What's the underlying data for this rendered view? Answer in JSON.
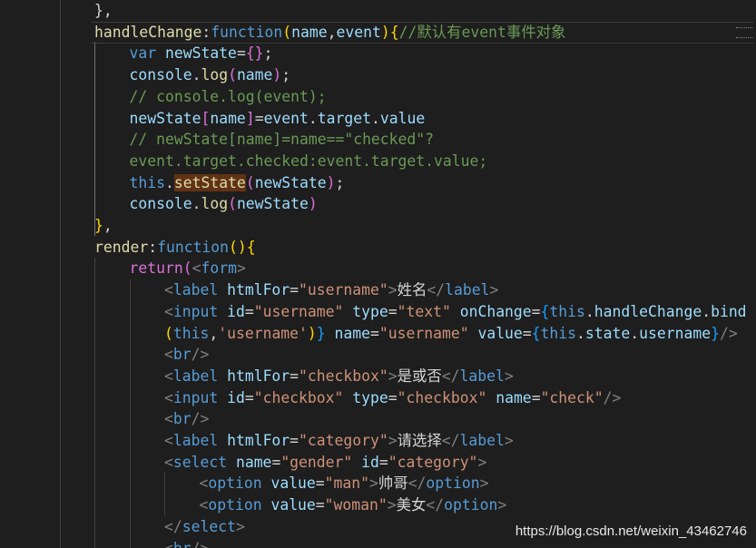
{
  "editor": {
    "lines": [
      {
        "indent": 2,
        "tokens": [
          {
            "t": "},",
            "c": "t-punc"
          }
        ]
      },
      {
        "indent": 2,
        "current": true,
        "tokens": [
          {
            "t": "handleChange",
            "c": "t-fn"
          },
          {
            "t": ":",
            "c": "t-punc"
          },
          {
            "t": "function",
            "c": "t-kw"
          },
          {
            "t": "(",
            "c": "t-brace1"
          },
          {
            "t": "name",
            "c": "t-var"
          },
          {
            "t": ",",
            "c": "t-punc"
          },
          {
            "t": "event",
            "c": "t-var"
          },
          {
            "t": ")",
            "c": "t-brace1"
          },
          {
            "t": "{",
            "c": "t-brace1"
          },
          {
            "t": "//默认有event事件对象",
            "c": "t-cmt"
          }
        ]
      },
      {
        "indent": 3,
        "tokens": [
          {
            "t": "var ",
            "c": "t-kw"
          },
          {
            "t": "newState",
            "c": "t-var"
          },
          {
            "t": "=",
            "c": "t-punc"
          },
          {
            "t": "{}",
            "c": "t-brace2"
          },
          {
            "t": ";",
            "c": "t-punc"
          }
        ]
      },
      {
        "indent": 3,
        "tokens": [
          {
            "t": "console",
            "c": "t-var"
          },
          {
            "t": ".",
            "c": "t-punc"
          },
          {
            "t": "log",
            "c": "t-fn"
          },
          {
            "t": "(",
            "c": "t-brace2"
          },
          {
            "t": "name",
            "c": "t-var"
          },
          {
            "t": ")",
            "c": "t-brace2"
          },
          {
            "t": ";",
            "c": "t-punc"
          }
        ]
      },
      {
        "indent": 3,
        "tokens": [
          {
            "t": "// console.log(event);",
            "c": "t-cmt"
          }
        ]
      },
      {
        "indent": 3,
        "tokens": [
          {
            "t": "newState",
            "c": "t-var"
          },
          {
            "t": "[",
            "c": "t-brace2"
          },
          {
            "t": "name",
            "c": "t-var"
          },
          {
            "t": "]",
            "c": "t-brace2"
          },
          {
            "t": "=",
            "c": "t-punc"
          },
          {
            "t": "event",
            "c": "t-var"
          },
          {
            "t": ".",
            "c": "t-punc"
          },
          {
            "t": "target",
            "c": "t-var"
          },
          {
            "t": ".",
            "c": "t-punc"
          },
          {
            "t": "value",
            "c": "t-var"
          }
        ]
      },
      {
        "indent": 3,
        "tokens": [
          {
            "t": "// newState[name]=name==\"checked\"?",
            "c": "t-cmt"
          }
        ]
      },
      {
        "indent": 3,
        "tokens": [
          {
            "t": "event.target.checked:event.target.value;",
            "c": "t-cmt"
          }
        ]
      },
      {
        "indent": 3,
        "tokens": [
          {
            "t": "this",
            "c": "t-this"
          },
          {
            "t": ".",
            "c": "t-punc"
          },
          {
            "t": "setState",
            "c": "t-fn t-sel"
          },
          {
            "t": "(",
            "c": "t-brace2"
          },
          {
            "t": "newState",
            "c": "t-var"
          },
          {
            "t": ")",
            "c": "t-brace2"
          },
          {
            "t": ";",
            "c": "t-punc"
          }
        ]
      },
      {
        "indent": 3,
        "tokens": [
          {
            "t": "console",
            "c": "t-var"
          },
          {
            "t": ".",
            "c": "t-punc"
          },
          {
            "t": "log",
            "c": "t-fn"
          },
          {
            "t": "(",
            "c": "t-brace2"
          },
          {
            "t": "newState",
            "c": "t-var"
          },
          {
            "t": ")",
            "c": "t-brace2"
          }
        ]
      },
      {
        "indent": 2,
        "tokens": [
          {
            "t": "}",
            "c": "t-brace1"
          },
          {
            "t": ",",
            "c": "t-punc"
          }
        ]
      },
      {
        "indent": 2,
        "tokens": [
          {
            "t": "render",
            "c": "t-fn"
          },
          {
            "t": ":",
            "c": "t-punc"
          },
          {
            "t": "function",
            "c": "t-kw"
          },
          {
            "t": "()",
            "c": "t-brace1"
          },
          {
            "t": "{",
            "c": "t-brace1"
          }
        ]
      },
      {
        "indent": 3,
        "tokens": [
          {
            "t": "return",
            "c": "t-brace2"
          },
          {
            "t": "(",
            "c": "t-brace2"
          },
          {
            "t": "<",
            "c": "t-ang"
          },
          {
            "t": "form",
            "c": "t-tag"
          },
          {
            "t": ">",
            "c": "t-ang"
          }
        ]
      },
      {
        "indent": 4,
        "tokens": [
          {
            "t": "<",
            "c": "t-ang"
          },
          {
            "t": "label ",
            "c": "t-tag"
          },
          {
            "t": "htmlFor",
            "c": "t-attr"
          },
          {
            "t": "=",
            "c": "t-punc"
          },
          {
            "t": "\"username\"",
            "c": "t-str"
          },
          {
            "t": ">",
            "c": "t-ang"
          },
          {
            "t": "姓名",
            "c": "t-text"
          },
          {
            "t": "</",
            "c": "t-ang"
          },
          {
            "t": "label",
            "c": "t-tag"
          },
          {
            "t": ">",
            "c": "t-ang"
          }
        ]
      },
      {
        "indent": 4,
        "tokens": [
          {
            "t": "<",
            "c": "t-ang"
          },
          {
            "t": "input ",
            "c": "t-tag"
          },
          {
            "t": "id",
            "c": "t-attr"
          },
          {
            "t": "=",
            "c": "t-punc"
          },
          {
            "t": "\"username\" ",
            "c": "t-str"
          },
          {
            "t": "type",
            "c": "t-attr"
          },
          {
            "t": "=",
            "c": "t-punc"
          },
          {
            "t": "\"text\" ",
            "c": "t-str"
          },
          {
            "t": "onChange",
            "c": "t-attr"
          },
          {
            "t": "=",
            "c": "t-punc"
          },
          {
            "t": "{",
            "c": "t-brace3"
          },
          {
            "t": "this",
            "c": "t-this"
          },
          {
            "t": ".",
            "c": "t-punc"
          },
          {
            "t": "handleChange",
            "c": "t-var"
          },
          {
            "t": ".",
            "c": "t-punc"
          },
          {
            "t": "bind",
            "c": "t-var"
          }
        ]
      },
      {
        "indent": 4,
        "tokens": [
          {
            "t": "(",
            "c": "t-brace1"
          },
          {
            "t": "this",
            "c": "t-this"
          },
          {
            "t": ",",
            "c": "t-punc"
          },
          {
            "t": "'username'",
            "c": "t-str"
          },
          {
            "t": ")",
            "c": "t-brace1"
          },
          {
            "t": "}",
            "c": "t-brace3"
          },
          {
            "t": " name",
            "c": "t-attr"
          },
          {
            "t": "=",
            "c": "t-punc"
          },
          {
            "t": "\"username\" ",
            "c": "t-str"
          },
          {
            "t": "value",
            "c": "t-attr"
          },
          {
            "t": "=",
            "c": "t-punc"
          },
          {
            "t": "{",
            "c": "t-brace3"
          },
          {
            "t": "this",
            "c": "t-this"
          },
          {
            "t": ".",
            "c": "t-punc"
          },
          {
            "t": "state",
            "c": "t-var"
          },
          {
            "t": ".",
            "c": "t-punc"
          },
          {
            "t": "username",
            "c": "t-var"
          },
          {
            "t": "}",
            "c": "t-brace3"
          },
          {
            "t": "/>",
            "c": "t-ang"
          }
        ]
      },
      {
        "indent": 4,
        "tokens": [
          {
            "t": "<",
            "c": "t-ang"
          },
          {
            "t": "br",
            "c": "t-tag"
          },
          {
            "t": "/>",
            "c": "t-ang"
          }
        ]
      },
      {
        "indent": 4,
        "tokens": [
          {
            "t": "<",
            "c": "t-ang"
          },
          {
            "t": "label ",
            "c": "t-tag"
          },
          {
            "t": "htmlFor",
            "c": "t-attr"
          },
          {
            "t": "=",
            "c": "t-punc"
          },
          {
            "t": "\"checkbox\"",
            "c": "t-str"
          },
          {
            "t": ">",
            "c": "t-ang"
          },
          {
            "t": "是或否",
            "c": "t-text"
          },
          {
            "t": "</",
            "c": "t-ang"
          },
          {
            "t": "label",
            "c": "t-tag"
          },
          {
            "t": ">",
            "c": "t-ang"
          }
        ]
      },
      {
        "indent": 4,
        "tokens": [
          {
            "t": "<",
            "c": "t-ang"
          },
          {
            "t": "input ",
            "c": "t-tag"
          },
          {
            "t": "id",
            "c": "t-attr"
          },
          {
            "t": "=",
            "c": "t-punc"
          },
          {
            "t": "\"checkbox\" ",
            "c": "t-str"
          },
          {
            "t": "type",
            "c": "t-attr"
          },
          {
            "t": "=",
            "c": "t-punc"
          },
          {
            "t": "\"checkbox\" ",
            "c": "t-str"
          },
          {
            "t": "name",
            "c": "t-attr"
          },
          {
            "t": "=",
            "c": "t-punc"
          },
          {
            "t": "\"check\"",
            "c": "t-str"
          },
          {
            "t": "/>",
            "c": "t-ang"
          }
        ]
      },
      {
        "indent": 4,
        "tokens": [
          {
            "t": "<",
            "c": "t-ang"
          },
          {
            "t": "br",
            "c": "t-tag"
          },
          {
            "t": "/>",
            "c": "t-ang"
          }
        ]
      },
      {
        "indent": 4,
        "tokens": [
          {
            "t": "<",
            "c": "t-ang"
          },
          {
            "t": "label ",
            "c": "t-tag"
          },
          {
            "t": "htmlFor",
            "c": "t-attr"
          },
          {
            "t": "=",
            "c": "t-punc"
          },
          {
            "t": "\"category\"",
            "c": "t-str"
          },
          {
            "t": ">",
            "c": "t-ang"
          },
          {
            "t": "请选择",
            "c": "t-text"
          },
          {
            "t": "</",
            "c": "t-ang"
          },
          {
            "t": "label",
            "c": "t-tag"
          },
          {
            "t": ">",
            "c": "t-ang"
          }
        ]
      },
      {
        "indent": 4,
        "tokens": [
          {
            "t": "<",
            "c": "t-ang"
          },
          {
            "t": "select ",
            "c": "t-tag"
          },
          {
            "t": "name",
            "c": "t-attr"
          },
          {
            "t": "=",
            "c": "t-punc"
          },
          {
            "t": "\"gender\" ",
            "c": "t-str"
          },
          {
            "t": "id",
            "c": "t-attr"
          },
          {
            "t": "=",
            "c": "t-punc"
          },
          {
            "t": "\"category\"",
            "c": "t-str"
          },
          {
            "t": ">",
            "c": "t-ang"
          }
        ]
      },
      {
        "indent": 5,
        "tokens": [
          {
            "t": "<",
            "c": "t-ang"
          },
          {
            "t": "option ",
            "c": "t-tag"
          },
          {
            "t": "value",
            "c": "t-attr"
          },
          {
            "t": "=",
            "c": "t-punc"
          },
          {
            "t": "\"man\"",
            "c": "t-str"
          },
          {
            "t": ">",
            "c": "t-ang"
          },
          {
            "t": "帅哥",
            "c": "t-text"
          },
          {
            "t": "</",
            "c": "t-ang"
          },
          {
            "t": "option",
            "c": "t-tag"
          },
          {
            "t": ">",
            "c": "t-ang"
          }
        ]
      },
      {
        "indent": 5,
        "tokens": [
          {
            "t": "<",
            "c": "t-ang"
          },
          {
            "t": "option ",
            "c": "t-tag"
          },
          {
            "t": "value",
            "c": "t-attr"
          },
          {
            "t": "=",
            "c": "t-punc"
          },
          {
            "t": "\"woman\"",
            "c": "t-str"
          },
          {
            "t": ">",
            "c": "t-ang"
          },
          {
            "t": "美女",
            "c": "t-text"
          },
          {
            "t": "</",
            "c": "t-ang"
          },
          {
            "t": "option",
            "c": "t-tag"
          },
          {
            "t": ">",
            "c": "t-ang"
          }
        ]
      },
      {
        "indent": 4,
        "tokens": [
          {
            "t": "</",
            "c": "t-ang"
          },
          {
            "t": "select",
            "c": "t-tag"
          },
          {
            "t": ">",
            "c": "t-ang"
          }
        ]
      },
      {
        "indent": 4,
        "tokens": [
          {
            "t": "<",
            "c": "t-ang"
          },
          {
            "t": "br",
            "c": "t-tag"
          },
          {
            "t": "/>",
            "c": "t-ang"
          }
        ]
      }
    ]
  },
  "watermark": "https://blog.csdn.net/weixin_43462746",
  "colors": {
    "background": "#1e1e1e",
    "keyword": "#569cd6",
    "variable": "#9cdcfe",
    "function": "#dcdcaa",
    "string": "#ce9178",
    "comment": "#6a9955"
  }
}
